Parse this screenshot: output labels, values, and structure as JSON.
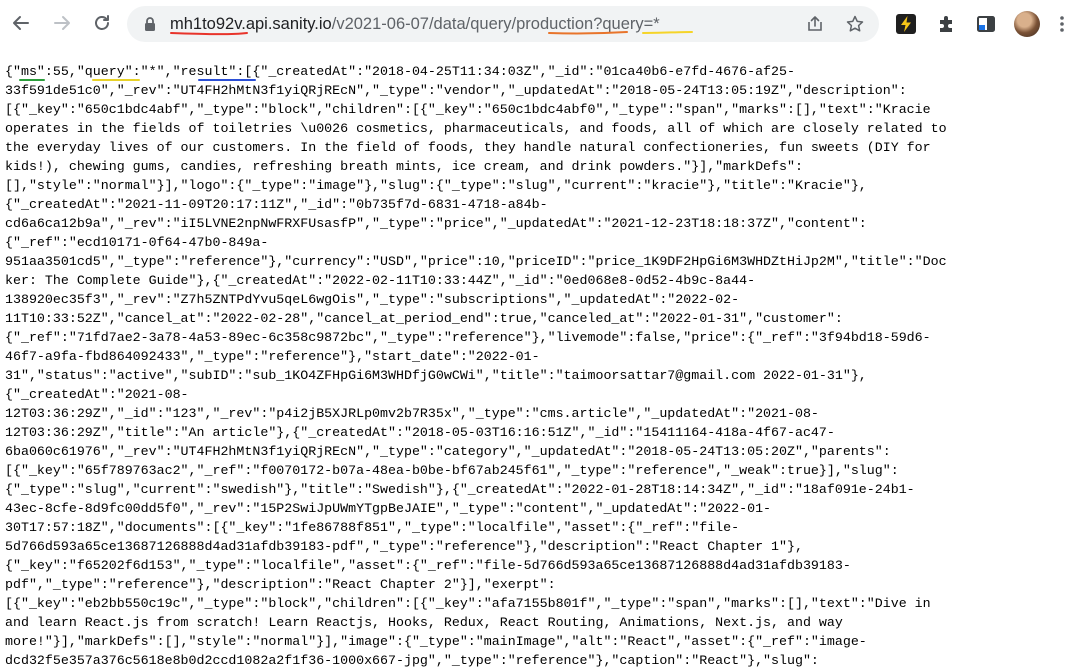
{
  "browser": {
    "url": {
      "host": "mh1to92v.api.sanity.io",
      "path_before": "/v2021-06-07/data/query/",
      "dataset": "production",
      "query_part": "?query=*"
    },
    "icons": {
      "back": "arrow-left-icon",
      "forward": "arrow-right-icon",
      "reload": "reload-icon",
      "lock": "lock-icon",
      "share": "share-icon",
      "bookmark": "star-icon",
      "extension_bolt": "bolt-extension-icon",
      "extensions": "puzzle-icon",
      "sidepanel": "side-panel-icon",
      "profile": "avatar",
      "menu": "kebab-menu-icon"
    },
    "colors": {
      "underline_red": "#e8342b",
      "underline_orange": "#e8742b",
      "underline_yellow": "#f5d428",
      "underline_green": "#2a9d3a",
      "underline_blue": "#2b4fd6",
      "bolt_bg": "#1f1f1f",
      "bolt_fg": "#f5c518"
    }
  },
  "content": {
    "lines": [
      "{\"ms\":55,\"query\":\"*\",\"result\":[{\"_createdAt\":\"2018-04-25T11:34:03Z\",\"_id\":\"01ca40b6-e7fd-4676-af25-",
      "33f591de51c0\",\"_rev\":\"UT4FH2hMtN3f1yiQRjREcN\",\"_type\":\"vendor\",\"_updatedAt\":\"2018-05-24T13:05:19Z\",\"description\":",
      "[{\"_key\":\"650c1bdc4abf\",\"_type\":\"block\",\"children\":[{\"_key\":\"650c1bdc4abf0\",\"_type\":\"span\",\"marks\":[],\"text\":\"Kracie",
      "operates in the fields of toiletries \\u0026 cosmetics, pharmaceuticals, and foods, all of which are closely related to",
      "the everyday lives of our customers. In the field of foods, they handle natural confectioneries, fun sweets (DIY for",
      "kids!), chewing gums, candies, refreshing breath mints, ice cream, and drink powders.\"}],\"markDefs\":",
      "[],\"style\":\"normal\"}],\"logo\":{\"_type\":\"image\"},\"slug\":{\"_type\":\"slug\",\"current\":\"kracie\"},\"title\":\"Kracie\"},",
      "{\"_createdAt\":\"2021-11-09T20:17:11Z\",\"_id\":\"0b735f7d-6831-4718-a84b-",
      "cd6a6ca12b9a\",\"_rev\":\"iI5LVNE2npNwFRXFUsasfP\",\"_type\":\"price\",\"_updatedAt\":\"2021-12-23T18:18:37Z\",\"content\":",
      "{\"_ref\":\"ecd10171-0f64-47b0-849a-",
      "951aa3501cd5\",\"_type\":\"reference\"},\"currency\":\"USD\",\"price\":10,\"priceID\":\"price_1K9DF2HpGi6M3WHDZtHiJp2M\",\"title\":\"Doc",
      "ker: The Complete Guide\"},{\"_createdAt\":\"2022-02-11T10:33:44Z\",\"_id\":\"0ed068e8-0d52-4b9c-8a44-",
      "138920ec35f3\",\"_rev\":\"Z7h5ZNTPdYvu5qeL6wgOis\",\"_type\":\"subscriptions\",\"_updatedAt\":\"2022-02-",
      "11T10:33:52Z\",\"cancel_at\":\"2022-02-28\",\"cancel_at_period_end\":true,\"canceled_at\":\"2022-01-31\",\"customer\":",
      "{\"_ref\":\"71fd7ae2-3a78-4a53-89ec-6c358c9872bc\",\"_type\":\"reference\"},\"livemode\":false,\"price\":{\"_ref\":\"3f94bd18-59d6-",
      "46f7-a9fa-fbd864092433\",\"_type\":\"reference\"},\"start_date\":\"2022-01-",
      "31\",\"status\":\"active\",\"subID\":\"sub_1KO4ZFHpGi6M3WHDfjG0wCWi\",\"title\":\"taimoorsattar7@gmail.com 2022-01-31\"},",
      "{\"_createdAt\":\"2021-08-",
      "12T03:36:29Z\",\"_id\":\"123\",\"_rev\":\"p4i2jB5XJRLp0mv2b7R35x\",\"_type\":\"cms.article\",\"_updatedAt\":\"2021-08-",
      "12T03:36:29Z\",\"title\":\"An article\"},{\"_createdAt\":\"2018-05-03T16:16:51Z\",\"_id\":\"15411164-418a-4f67-ac47-",
      "6ba060c61976\",\"_rev\":\"UT4FH2hMtN3f1yiQRjREcN\",\"_type\":\"category\",\"_updatedAt\":\"2018-05-24T13:05:20Z\",\"parents\":",
      "[{\"_key\":\"65f789763ac2\",\"_ref\":\"f0070172-b07a-48ea-b0be-bf67ab245f61\",\"_type\":\"reference\",\"_weak\":true}],\"slug\":",
      "{\"_type\":\"slug\",\"current\":\"swedish\"},\"title\":\"Swedish\"},{\"_createdAt\":\"2022-01-28T18:14:34Z\",\"_id\":\"18af091e-24b1-",
      "43ec-8cfe-8d9fc00dd5f0\",\"_rev\":\"15P2SwiJpUWmYTgpBeJAIE\",\"_type\":\"content\",\"_updatedAt\":\"2022-01-",
      "30T17:57:18Z\",\"documents\":[{\"_key\":\"1fe86788f851\",\"_type\":\"localfile\",\"asset\":{\"_ref\":\"file-",
      "5d766d593a65ce13687126888d4ad31afdb39183-pdf\",\"_type\":\"reference\"},\"description\":\"React Chapter 1\"},",
      "{\"_key\":\"f65202f6d153\",\"_type\":\"localfile\",\"asset\":{\"_ref\":\"file-5d766d593a65ce13687126888d4ad31afdb39183-",
      "pdf\",\"_type\":\"reference\"},\"description\":\"React Chapter 2\"}],\"exerpt\":",
      "[{\"_key\":\"eb2bb550c19c\",\"_type\":\"block\",\"children\":[{\"_key\":\"afa7155b801f\",\"_type\":\"span\",\"marks\":[],\"text\":\"Dive in",
      "and learn React.js from scratch! Learn Reactjs, Hooks, Redux, React Routing, Animations, Next.js, and way",
      "more!\"}],\"markDefs\":[],\"style\":\"normal\"}],\"image\":{\"_type\":\"mainImage\",\"alt\":\"React\",\"asset\":{\"_ref\":\"image-",
      "dcd32f5e357a376c5618e8b0d2ccd1082a2f1f36-1000x667-jpg\",\"_type\":\"reference\"},\"caption\":\"React\"},\"slug\":"
    ]
  }
}
